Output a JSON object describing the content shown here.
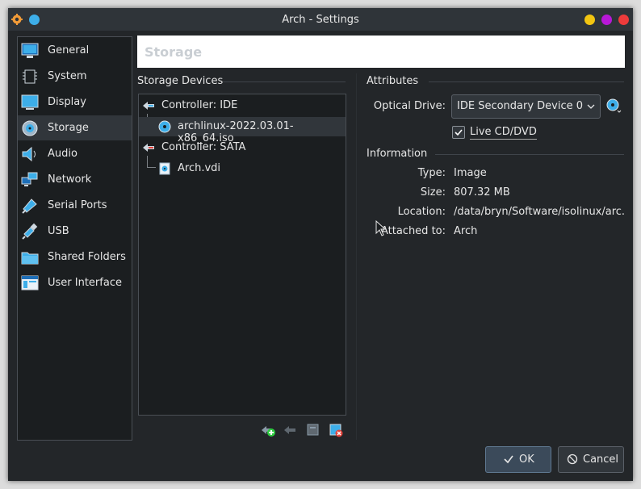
{
  "window": {
    "title": "Arch - Settings"
  },
  "titlebar_buttons": [
    {
      "name": "minimize-button",
      "color": "#f2c511"
    },
    {
      "name": "maximize-button",
      "color": "#b818d8"
    },
    {
      "name": "close-button",
      "color": "#ed3b3b"
    }
  ],
  "sidebar": {
    "items": [
      {
        "label": "General",
        "icon": "general-icon"
      },
      {
        "label": "System",
        "icon": "system-icon"
      },
      {
        "label": "Display",
        "icon": "display-icon"
      },
      {
        "label": "Storage",
        "icon": "storage-icon",
        "selected": true
      },
      {
        "label": "Audio",
        "icon": "audio-icon"
      },
      {
        "label": "Network",
        "icon": "network-icon"
      },
      {
        "label": "Serial Ports",
        "icon": "serial-ports-icon"
      },
      {
        "label": "USB",
        "icon": "usb-icon"
      },
      {
        "label": "Shared Folders",
        "icon": "shared-folders-icon"
      },
      {
        "label": "User Interface",
        "icon": "user-interface-icon"
      }
    ]
  },
  "page": {
    "header": "Storage"
  },
  "storage_devices": {
    "title": "Storage Devices",
    "tree": [
      {
        "label": "Controller: IDE",
        "kind": "controller-ide"
      },
      {
        "label": "archlinux-2022.03.01-x86_64.iso",
        "kind": "optical-disc",
        "selected": true
      },
      {
        "label": "Controller: SATA",
        "kind": "controller-sata"
      },
      {
        "label": "Arch.vdi",
        "kind": "hard-disk"
      }
    ],
    "toolbar_icons": [
      "add-attachment-icon",
      "remove-attachment-icon",
      "add-controller-icon",
      "remove-controller-icon"
    ]
  },
  "attributes": {
    "title": "Attributes",
    "optical_drive_label": "Optical Drive:",
    "optical_drive_value": "IDE Secondary Device 0",
    "live_cd_label": "Live CD/DVD",
    "live_cd_checked": true
  },
  "information": {
    "title": "Information",
    "rows": [
      {
        "label": "Type:",
        "value": "Image"
      },
      {
        "label": "Size:",
        "value": "807.32 MB"
      },
      {
        "label": "Location:",
        "value": "/data/bryn/Software/isolinux/arc..."
      },
      {
        "label": "Attached to:",
        "value": "Arch"
      }
    ]
  },
  "buttons": {
    "ok": "OK",
    "cancel": "Cancel"
  },
  "colors": {
    "accent": "#3daee9",
    "background": "#232629",
    "panel": "#1b1e20",
    "selection": "#31363b"
  }
}
